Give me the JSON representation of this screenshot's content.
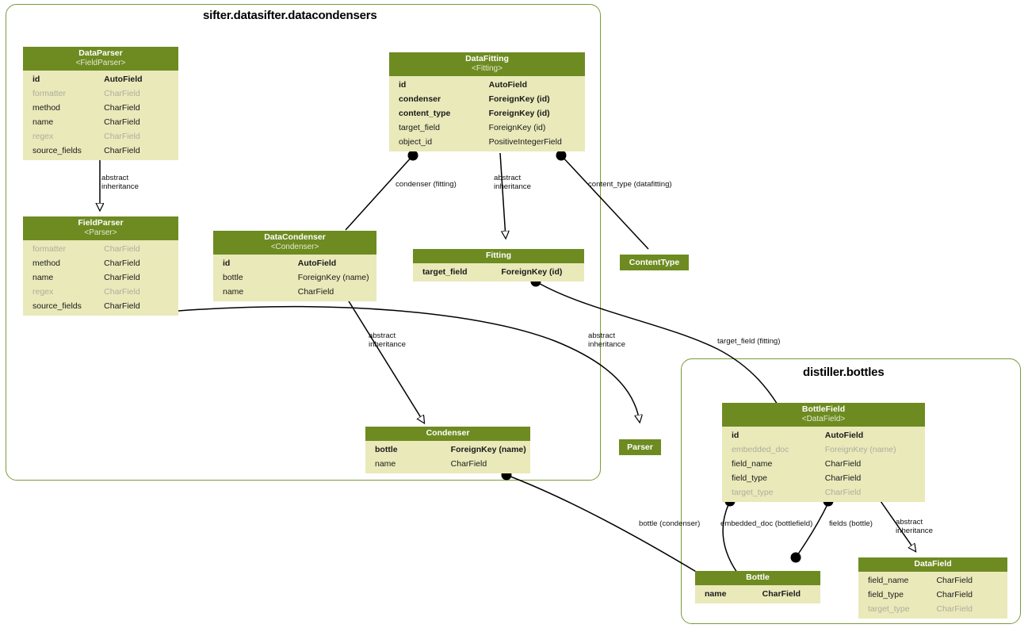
{
  "diagram": {
    "type": "django-model-graph",
    "colors": {
      "header_bg": "#6e8b21",
      "body_bg": "#e9e9ba",
      "cluster_border": "#7a9b3a",
      "muted_text": "#aeae9c",
      "edge": "#000000"
    }
  },
  "clusters": [
    {
      "id": "c1",
      "title": "sifter.datasifter.datacondensers"
    },
    {
      "id": "c2",
      "title": "distiller.bottles"
    }
  ],
  "tables": [
    {
      "id": "dataparser",
      "name": "DataParser",
      "base": "<FieldParser>",
      "fields": [
        {
          "name": "id",
          "type": "AutoField",
          "bold": true,
          "muted": false
        },
        {
          "name": "formatter",
          "type": "CharField",
          "bold": false,
          "muted": true
        },
        {
          "name": "method",
          "type": "CharField",
          "bold": false,
          "muted": false
        },
        {
          "name": "name",
          "type": "CharField",
          "bold": false,
          "muted": false
        },
        {
          "name": "regex",
          "type": "CharField",
          "bold": false,
          "muted": true
        },
        {
          "name": "source_fields",
          "type": "CharField",
          "bold": false,
          "muted": false
        }
      ]
    },
    {
      "id": "datafitting",
      "name": "DataFitting",
      "base": "<Fitting>",
      "fields": [
        {
          "name": "id",
          "type": "AutoField",
          "bold": true,
          "muted": false
        },
        {
          "name": "condenser",
          "type": "ForeignKey (id)",
          "bold": true,
          "muted": false
        },
        {
          "name": "content_type",
          "type": "ForeignKey (id)",
          "bold": true,
          "muted": false
        },
        {
          "name": "target_field",
          "type": "ForeignKey (id)",
          "bold": false,
          "muted": false
        },
        {
          "name": "object_id",
          "type": "PositiveIntegerField",
          "bold": false,
          "muted": false
        }
      ]
    },
    {
      "id": "fieldparser",
      "name": "FieldParser",
      "base": "<Parser>",
      "fields": [
        {
          "name": "formatter",
          "type": "CharField",
          "bold": false,
          "muted": true
        },
        {
          "name": "method",
          "type": "CharField",
          "bold": false,
          "muted": false
        },
        {
          "name": "name",
          "type": "CharField",
          "bold": false,
          "muted": false
        },
        {
          "name": "regex",
          "type": "CharField",
          "bold": false,
          "muted": true
        },
        {
          "name": "source_fields",
          "type": "CharField",
          "bold": false,
          "muted": false
        }
      ]
    },
    {
      "id": "datacondenser",
      "name": "DataCondenser",
      "base": "<Condenser>",
      "fields": [
        {
          "name": "id",
          "type": "AutoField",
          "bold": true,
          "muted": false
        },
        {
          "name": "bottle",
          "type": "ForeignKey (name)",
          "bold": false,
          "muted": false
        },
        {
          "name": "name",
          "type": "CharField",
          "bold": false,
          "muted": false
        }
      ]
    },
    {
      "id": "fitting",
      "name": "Fitting",
      "base": "",
      "fields": [
        {
          "name": "target_field",
          "type": "ForeignKey (id)",
          "bold": true,
          "muted": false
        }
      ]
    },
    {
      "id": "condenser",
      "name": "Condenser",
      "base": "",
      "fields": [
        {
          "name": "bottle",
          "type": "ForeignKey (name)",
          "bold": true,
          "muted": false
        },
        {
          "name": "name",
          "type": "CharField",
          "bold": false,
          "muted": false
        }
      ]
    },
    {
      "id": "bottlefield",
      "name": "BottleField",
      "base": "<DataField>",
      "fields": [
        {
          "name": "id",
          "type": "AutoField",
          "bold": true,
          "muted": false
        },
        {
          "name": "embedded_doc",
          "type": "ForeignKey (name)",
          "bold": false,
          "muted": true
        },
        {
          "name": "field_name",
          "type": "CharField",
          "bold": false,
          "muted": false
        },
        {
          "name": "field_type",
          "type": "CharField",
          "bold": false,
          "muted": false
        },
        {
          "name": "target_type",
          "type": "CharField",
          "bold": false,
          "muted": true
        }
      ]
    },
    {
      "id": "bottle",
      "name": "Bottle",
      "base": "",
      "fields": [
        {
          "name": "name",
          "type": "CharField",
          "bold": true,
          "muted": false
        }
      ]
    },
    {
      "id": "datafield",
      "name": "DataField",
      "base": "",
      "fields": [
        {
          "name": "field_name",
          "type": "CharField",
          "bold": false,
          "muted": false
        },
        {
          "name": "field_type",
          "type": "CharField",
          "bold": false,
          "muted": false
        },
        {
          "name": "target_type",
          "type": "CharField",
          "bold": false,
          "muted": true
        }
      ]
    }
  ],
  "simple_nodes": [
    {
      "id": "contenttype",
      "name": "ContentType"
    },
    {
      "id": "parser",
      "name": "Parser"
    }
  ],
  "edge_labels": [
    {
      "id": "l1",
      "text": "abstract\ninheritance"
    },
    {
      "id": "l2",
      "text": "condenser (fitting)"
    },
    {
      "id": "l3",
      "text": "abstract\ninheritance"
    },
    {
      "id": "l4",
      "text": "content_type (datafitting)"
    },
    {
      "id": "l5",
      "text": "abstract\ninheritance"
    },
    {
      "id": "l6",
      "text": "abstract\ninheritance"
    },
    {
      "id": "l7",
      "text": "target_field (fitting)"
    },
    {
      "id": "l8",
      "text": "bottle (condenser)"
    },
    {
      "id": "l9",
      "text": "embedded_doc (bottlefield)"
    },
    {
      "id": "l10",
      "text": "fields (bottle)"
    },
    {
      "id": "l11",
      "text": "abstract\ninheritance"
    }
  ]
}
